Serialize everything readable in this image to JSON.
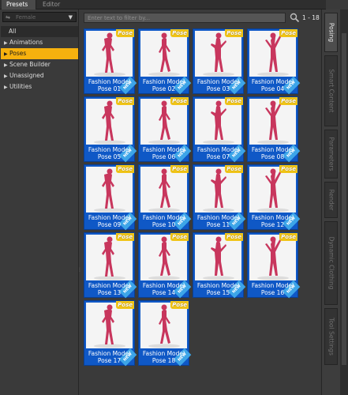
{
  "tabs": {
    "presets": "Presets",
    "editor": "Editor"
  },
  "filter_dropdown": {
    "value": "Female",
    "icon": "figure-filter-icon"
  },
  "categories": [
    {
      "label": "All",
      "expandable": false
    },
    {
      "label": "Animations",
      "expandable": true
    },
    {
      "label": "Poses",
      "expandable": true,
      "selected": true
    },
    {
      "label": "Scene Builder",
      "expandable": true
    },
    {
      "label": "Unassigned",
      "expandable": true
    },
    {
      "label": "Utilities",
      "expandable": true
    }
  ],
  "search": {
    "placeholder": "Enter text to filter by...",
    "range": "1 - 18"
  },
  "items": [
    {
      "line1": "Fashion Model",
      "line2": "Pose 01",
      "badge": "Pose"
    },
    {
      "line1": "Fashion Model",
      "line2": "Pose 02",
      "badge": "Pose"
    },
    {
      "line1": "Fashion Model",
      "line2": "Pose 03",
      "badge": "Pose"
    },
    {
      "line1": "Fashion Model",
      "line2": "Pose 04",
      "badge": "Pose"
    },
    {
      "line1": "Fashion Model",
      "line2": "Pose 05",
      "badge": "Pose"
    },
    {
      "line1": "Fashion Model",
      "line2": "Pose 06",
      "badge": "Pose"
    },
    {
      "line1": "Fashion Model",
      "line2": "Pose 07",
      "badge": "Pose"
    },
    {
      "line1": "Fashion Model",
      "line2": "Pose 08",
      "badge": "Pose"
    },
    {
      "line1": "Fashion Model",
      "line2": "Pose 09",
      "badge": "Pose"
    },
    {
      "line1": "Fashion Model",
      "line2": "Pose 10",
      "badge": "Pose"
    },
    {
      "line1": "Fashion Model",
      "line2": "Pose 11",
      "badge": "Pose"
    },
    {
      "line1": "Fashion Model",
      "line2": "Pose 12",
      "badge": "Pose"
    },
    {
      "line1": "Fashion Model",
      "line2": "Pose 13",
      "badge": "Pose"
    },
    {
      "line1": "Fashion Model",
      "line2": "Pose 14",
      "badge": "Pose"
    },
    {
      "line1": "Fashion Model",
      "line2": "Pose 15",
      "badge": "Pose"
    },
    {
      "line1": "Fashion Model",
      "line2": "Pose 16",
      "badge": "Pose"
    },
    {
      "line1": "Fashion Model",
      "line2": "Pose 17",
      "badge": "Pose"
    },
    {
      "line1": "Fashion Model",
      "line2": "Pose 18",
      "badge": "Pose"
    }
  ],
  "new_ribbon": "NEW",
  "right_tabs": [
    "Posing",
    "Smart Content",
    "Parameters",
    "Render",
    "Dynamic Clothing",
    "Tool Settings"
  ],
  "colors": {
    "accent": "#f6b10e",
    "tile_blue": "#0f58c6",
    "figure": "#c8365d",
    "badge": "#f0c417"
  }
}
